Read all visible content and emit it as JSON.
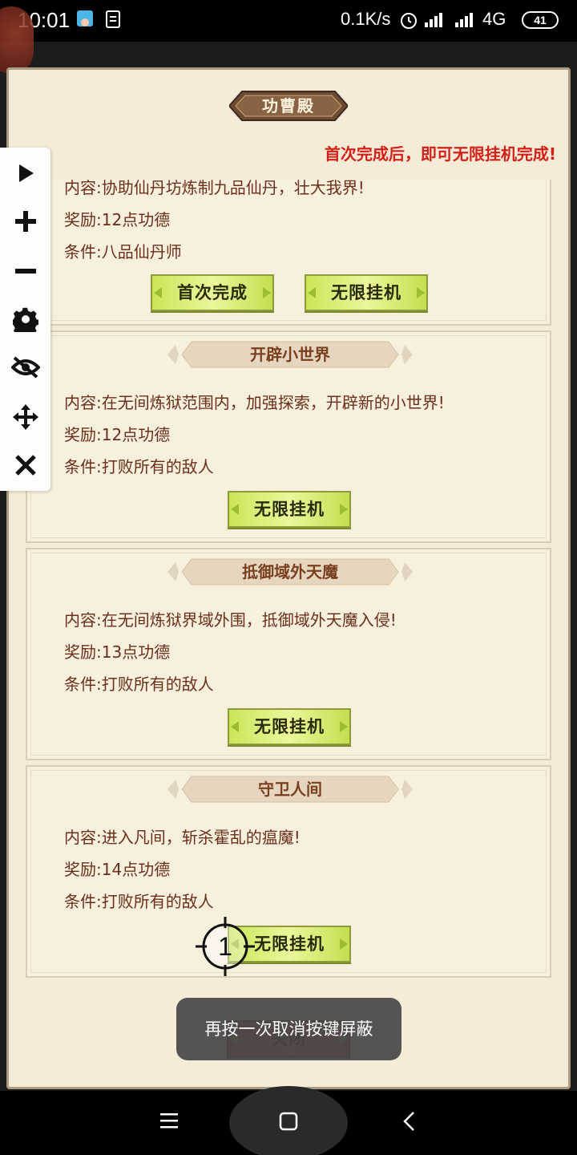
{
  "status_bar": {
    "time": "10:01",
    "net_rate": "0.1K/s",
    "network": "4G",
    "battery": "41"
  },
  "panel": {
    "title": "功曹殿",
    "notice": "首次完成后，即可无限挂机完成!"
  },
  "tasks": [
    {
      "name": "",
      "content_label": "内容:",
      "content": "协助仙丹坊炼制九品仙丹，壮大我界!",
      "reward_label": "奖励:",
      "reward": "12点功德",
      "condition_label": "条件:",
      "condition": "八品仙丹师",
      "buttons": [
        "首次完成",
        "无限挂机"
      ]
    },
    {
      "name": "开辟小世界",
      "content_label": "内容:",
      "content": "在无间炼狱范围内，加强探索，开辟新的小世界!",
      "reward_label": "奖励:",
      "reward": "12点功德",
      "condition_label": "条件:",
      "condition": "打败所有的敌人",
      "buttons": [
        "无限挂机"
      ]
    },
    {
      "name": "抵御域外天魔",
      "content_label": "内容:",
      "content": "在无间炼狱界域外围，抵御域外天魔入侵!",
      "reward_label": "奖励:",
      "reward": "13点功德",
      "condition_label": "条件:",
      "condition": "打败所有的敌人",
      "buttons": [
        "无限挂机"
      ]
    },
    {
      "name": "守卫人间",
      "content_label": "内容:",
      "content": "进入凡间，斩杀霍乱的瘟魔!",
      "reward_label": "奖励:",
      "reward": "14点功德",
      "condition_label": "条件:",
      "condition": "打败所有的敌人",
      "buttons": [
        "无限挂机"
      ]
    }
  ],
  "bottom_button": "关闭",
  "toolbar": {
    "icons": [
      "play-icon",
      "plus-icon",
      "minus-icon",
      "gear-icon",
      "eye-off-icon",
      "move-icon",
      "close-icon"
    ]
  },
  "crosshair": {
    "label": "1"
  },
  "toast": "再按一次取消按键屏蔽",
  "nav": {
    "icons": [
      "menu-icon",
      "home-icon",
      "back-icon"
    ]
  }
}
